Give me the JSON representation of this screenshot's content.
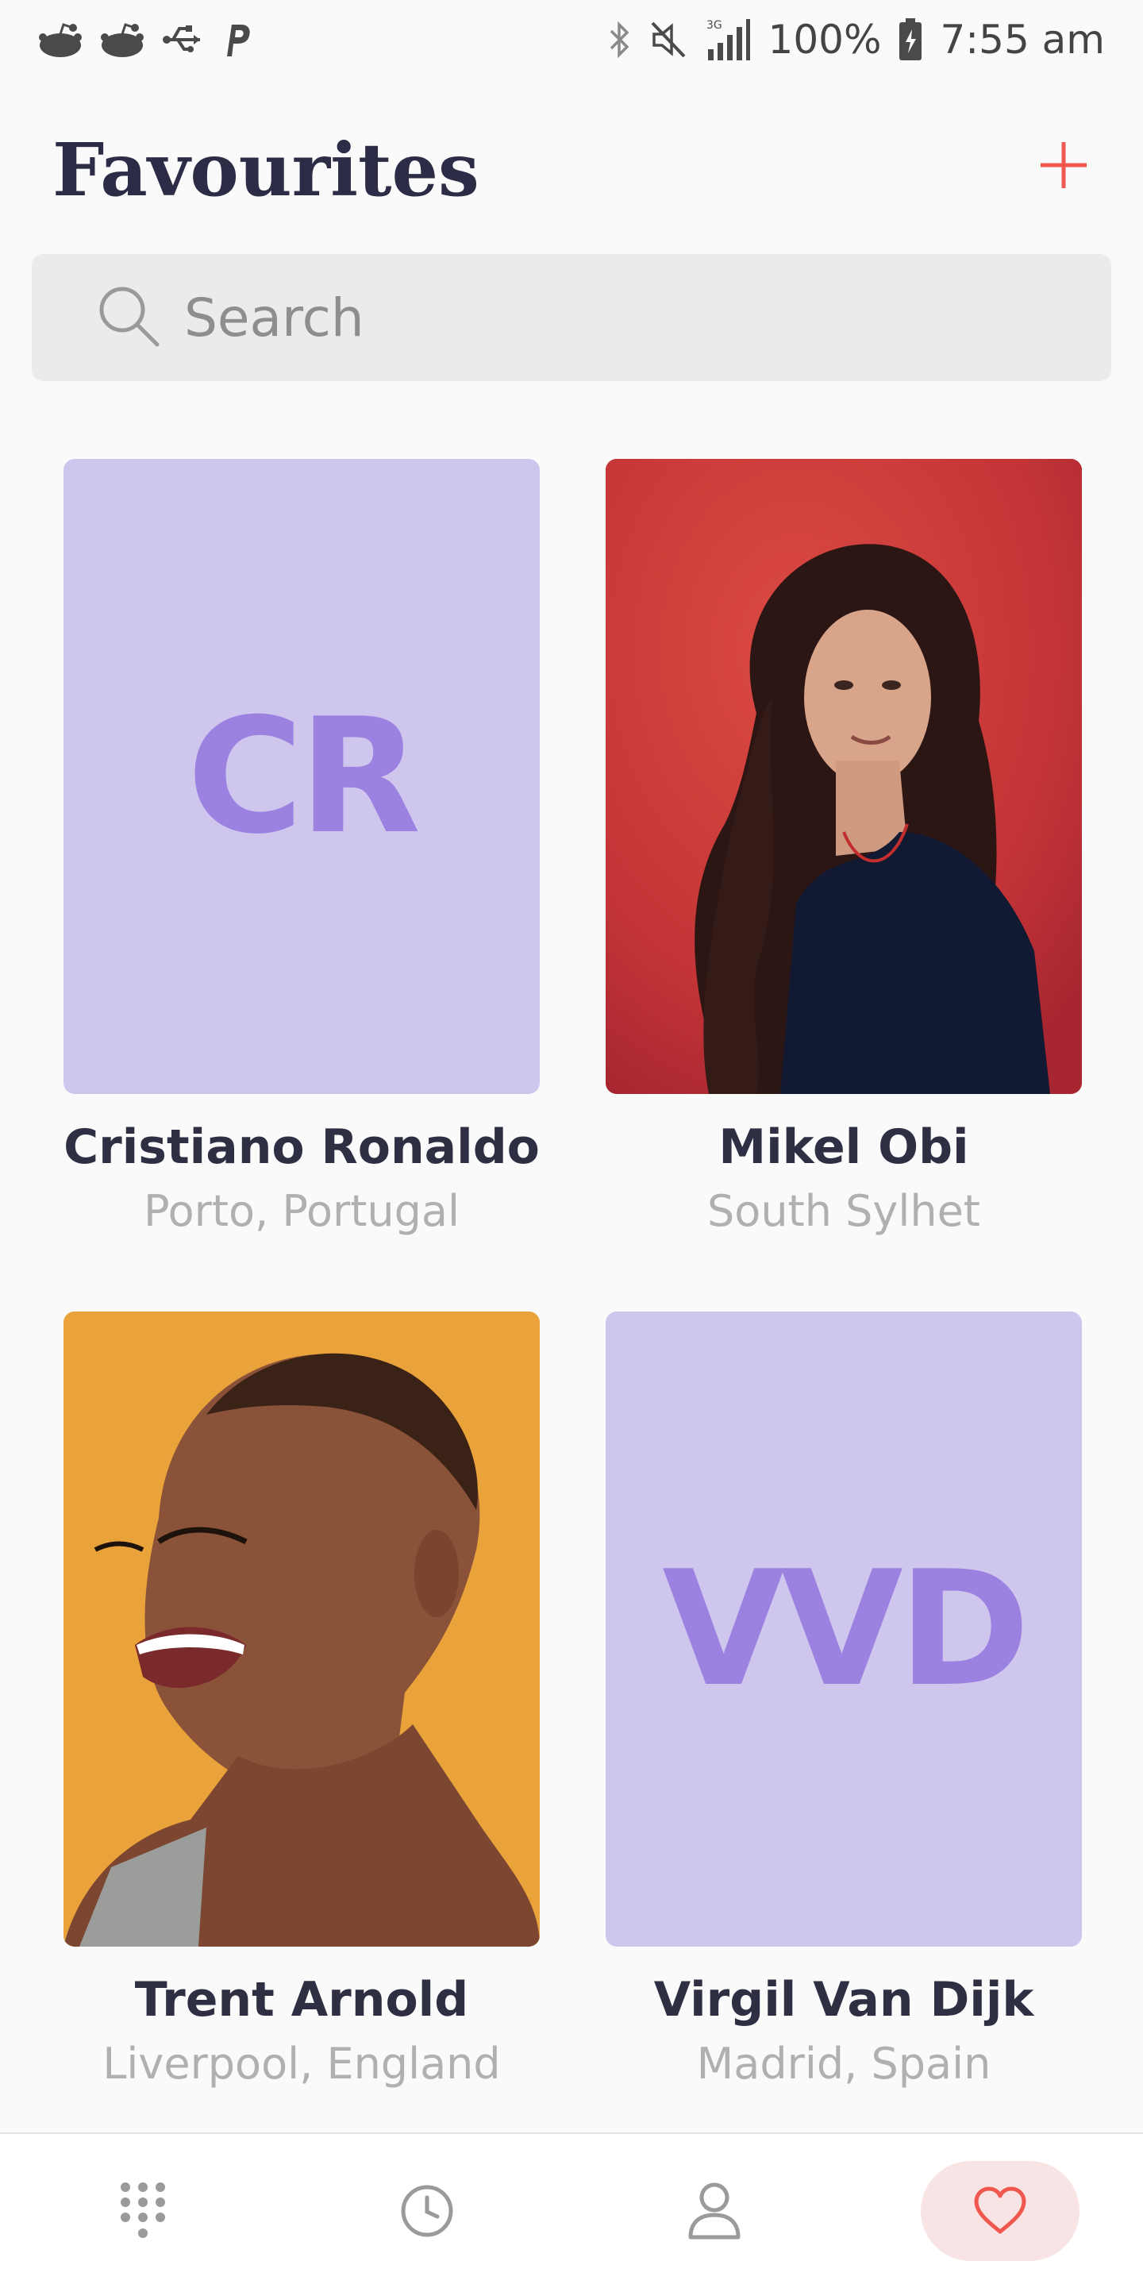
{
  "status_bar": {
    "left_icons": [
      "reddit-icon",
      "reddit-icon",
      "usb-icon",
      "paypal-icon"
    ],
    "right_icons": [
      "bluetooth-icon",
      "mute-icon",
      "signal-3g-icon",
      "battery-icon"
    ],
    "battery": "100%",
    "time": "7:55 am"
  },
  "header": {
    "title": "Favourites",
    "add_icon": "plus-icon"
  },
  "search": {
    "placeholder": "Search",
    "icon": "search-icon"
  },
  "favourites": [
    {
      "name": "Cristiano Ronaldo",
      "location": "Porto, Portugal",
      "initials": "CR",
      "photo": "initials"
    },
    {
      "name": "Mikel Obi",
      "location": "South Sylhet",
      "initials": "",
      "photo": "woman-red-wall"
    },
    {
      "name": "Trent Arnold",
      "location": "Liverpool, England",
      "initials": "",
      "photo": "woman-laughing-orange"
    },
    {
      "name": "Virgil Van Dijk",
      "location": "Madrid, Spain",
      "initials": "VVD",
      "photo": "initials"
    }
  ],
  "bottom_nav": [
    {
      "icon": "keypad-icon",
      "active": false
    },
    {
      "icon": "clock-icon",
      "active": false
    },
    {
      "icon": "person-icon",
      "active": false
    },
    {
      "icon": "heart-icon",
      "active": true
    }
  ],
  "colors": {
    "accent": "#f0584f",
    "avatar_bg": "#cfc6ee",
    "avatar_text": "#9b82e0",
    "active_nav_bg": "#f8e4e4"
  }
}
